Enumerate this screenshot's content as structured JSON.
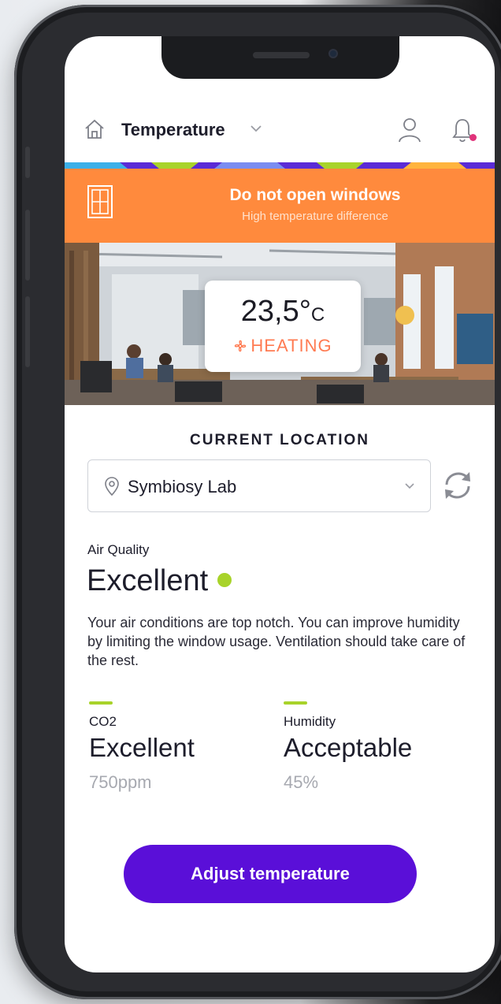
{
  "header": {
    "title": "Temperature"
  },
  "banner": {
    "title": "Do not open windows",
    "subtitle": "High temperature difference",
    "icon": "window-icon",
    "color": "#ff8a3d"
  },
  "temperature": {
    "value": "23,5°",
    "unit": "C",
    "status": "HEATING",
    "status_icon": "fan-icon"
  },
  "location": {
    "label": "CURRENT LOCATION",
    "selected": "Symbiosy Lab"
  },
  "air_quality": {
    "label": "Air Quality",
    "value": "Excellent",
    "description": "Your air conditions are top notch. You can improve humidity by limiting the window usage. Ventilation should take care of the rest.",
    "status_color": "#a8d32a"
  },
  "metrics": [
    {
      "label": "CO2",
      "value": "Excellent",
      "reading": "750ppm"
    },
    {
      "label": "Humidity",
      "value": "Acceptable",
      "reading": "45%"
    }
  ],
  "action": {
    "label": "Adjust temperature",
    "color": "#5a0fd8"
  }
}
